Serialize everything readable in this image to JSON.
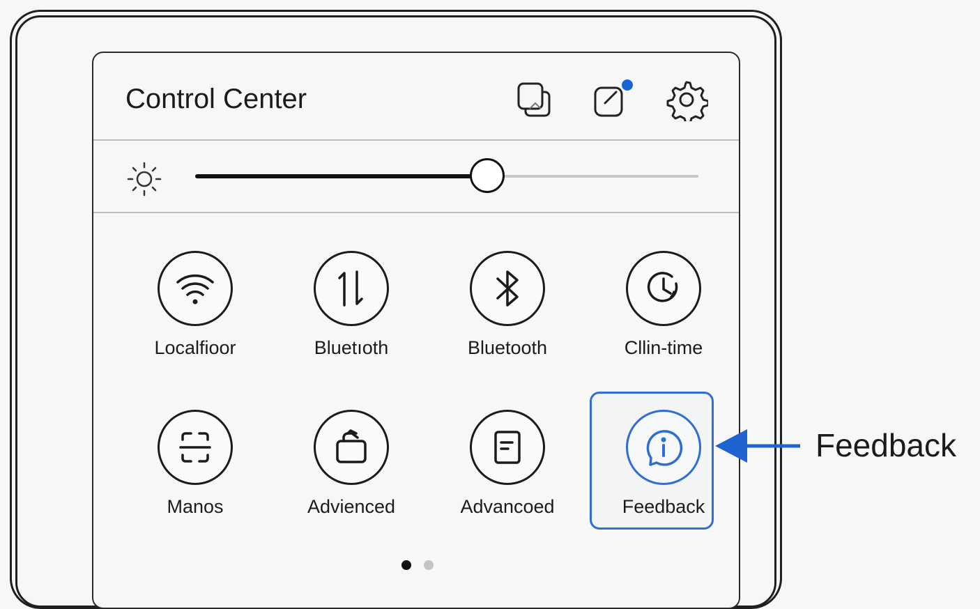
{
  "control_center": {
    "title": "Control Center",
    "header_icons": [
      "screens-icon",
      "edit-icon",
      "gear-icon"
    ],
    "notification_dot_color": "#1565d8"
  },
  "brightness": {
    "icon": "sun-icon",
    "level_fraction": 0.58
  },
  "tiles": [
    {
      "label": "Localfioor",
      "icon": "wifi-icon"
    },
    {
      "label": "Bluetıoth",
      "icon": "data-transfer-icon"
    },
    {
      "label": "Bluetooth",
      "icon": "bluetooth-icon"
    },
    {
      "label": "Cllin-time",
      "icon": "clock-icon"
    },
    {
      "label": "Manos",
      "icon": "scan-icon"
    },
    {
      "label": "Advienced",
      "icon": "bag-icon"
    },
    {
      "label": "Advancoed",
      "icon": "document-icon"
    },
    {
      "label": "Feedback",
      "icon": "info-icon",
      "selected": true
    }
  ],
  "page_indicator": {
    "pages": 2,
    "current": 1
  },
  "annotation": {
    "label": "Feedback",
    "color": "#1f63d0"
  },
  "colors": {
    "accent": "#2f6ed4",
    "text": "#1b1b1b",
    "background": "#f7f7f6"
  }
}
